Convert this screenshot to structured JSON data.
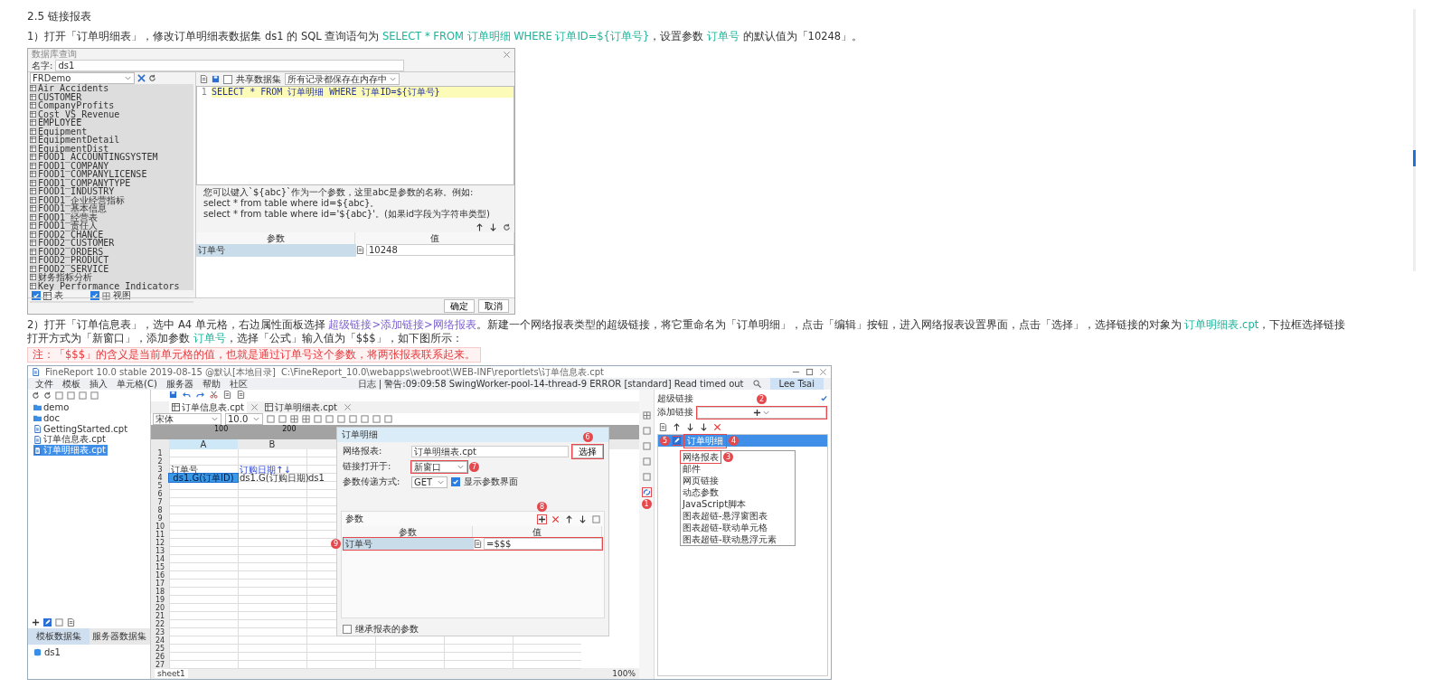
{
  "heading": "2.5 链接报表",
  "step_1": {
    "segments": [
      {
        "kind": "text",
        "text": "1）打开「订单明细表」，修改订单明细表数据集 ds1 的 SQL 查询语句为 "
      },
      {
        "kind": "code",
        "text": "SELECT * FROM 订单明细 WHERE 订单ID=${订单号}"
      },
      {
        "kind": "text",
        "text": "，设置参数 "
      },
      {
        "kind": "code",
        "text": "订单号"
      },
      {
        "kind": "text",
        "text": " 的默认值为「10248」。"
      }
    ]
  },
  "query_dialog": {
    "title": "数据库查询",
    "name_label": "名字:",
    "name_value": "ds1",
    "connection": "FRDemo",
    "tables": [
      "Air_Accidents",
      "CUSTOMER",
      "CompanyProfits",
      "Cost_VS_Revenue",
      "EMPLOYEE",
      "Equipment",
      "EquipmentDetail",
      "EquipmentDist",
      "FOOD1_ACCOUNTINGSYSTEM",
      "FOOD1_COMPANY",
      "FOOD1_COMPANYLICENSE",
      "FOOD1_COMPANYTYPE",
      "FOOD1_INDUSTRY",
      "FOOD1_企业经营指标",
      "FOOD1_基本信息",
      "FOOD1_经营表",
      "FOOD1_责任人",
      "FOOD2_CHANCE",
      "FOOD2_CUSTOMER",
      "FOOD2_ORDERS",
      "FOOD2_PRODUCT",
      "FOOD2_SERVICE",
      "财务指标分析",
      "Key Performance Indicators"
    ],
    "show_tables": {
      "label": "表",
      "checked": true
    },
    "show_views": {
      "label": "视图",
      "checked": true
    },
    "share_dataset": {
      "label": "共享数据集",
      "checked": false
    },
    "storage_mode": "所有记录都保存在内存中",
    "sql_lines": [
      {
        "number": "1",
        "text": "SELECT * FROM 订单明细 WHERE 订单ID=${订单号}"
      }
    ],
    "hint_lines": [
      "您可以键入`${abc}`作为一个参数，这里abc是参数的名称。例如:",
      "select * from table where id=${abc}。",
      "select * from table where id='${abc}'。(如果id字段为字符串类型)"
    ],
    "param_columns": [
      "参数",
      "值"
    ],
    "params": [
      {
        "name": "订单号",
        "value": "10248",
        "selected": true
      }
    ],
    "buttons": [
      "确定",
      "取消"
    ]
  },
  "step_2": {
    "segments": [
      {
        "kind": "text",
        "text": "2）打开「订单信息表」，选中 A4 单元格，右边属性面板选择 "
      },
      {
        "kind": "path",
        "text": "超级链接>添加链接>网络报表"
      },
      {
        "kind": "text",
        "text": "。新建一个网络报表类型的超级链接，将它重命名为「订单明细」，点击「编辑」按钮，进入网络报表设置界面，点击「选择」，选择链接的对象为 "
      },
      {
        "kind": "code",
        "text": "订单明细表.cpt"
      },
      {
        "kind": "text",
        "text": "，下拉框选择链接打开方式为「新窗口」，添加参数 "
      },
      {
        "kind": "code",
        "text": "订单号"
      },
      {
        "kind": "text",
        "text": "，选择「公式」输入值为「$$$」，如下图所示："
      }
    ]
  },
  "note": "注：「$$$」的含义是当前单元格的值，也就是通过订单号这个参数，将两张报表联系起来。",
  "designer_window": {
    "title": "FineReport 10.0 stable 2019-08-15 @默认[本地目录]",
    "path": "C:\\FineReport_10.0\\webapps\\webroot\\WEB-INF\\reportlets\\订单信息表.cpt",
    "menu": [
      "文件",
      "模板",
      "插入",
      "单元格(C)",
      "服务器",
      "帮助",
      "社区"
    ],
    "log": "日志 | 警告:09:09:58 SwingWorker-pool-14-thread-9 ERROR [standard] Read timed out",
    "user": "Lee Tsai",
    "file_tree": [
      {
        "label": "demo",
        "kind": "folder",
        "selected": false
      },
      {
        "label": "doc",
        "kind": "folder",
        "selected": false
      },
      {
        "label": "GettingStarted.cpt",
        "kind": "file",
        "selected": false
      },
      {
        "label": "订单信息表.cpt",
        "kind": "file",
        "selected": false
      },
      {
        "label": "订单明细表.cpt",
        "kind": "file",
        "selected": true
      }
    ],
    "dataset_tabs": [
      {
        "label": "模板数据集",
        "selected": true
      },
      {
        "label": "服务器数据集",
        "selected": false
      }
    ],
    "datasets": [
      "ds1"
    ],
    "doc_tabs": [
      {
        "label": "订单信息表.cpt",
        "selected": true
      },
      {
        "label": "订单明细表.cpt",
        "selected": false
      }
    ],
    "font": "宋体",
    "font_size": "10.0",
    "ruler_labels": [
      "100",
      "200"
    ],
    "columns": [
      "A",
      "B"
    ],
    "rows": [
      {
        "number": "1",
        "cells": []
      },
      {
        "number": "2",
        "cells": []
      },
      {
        "number": "3",
        "cells": [
          {
            "text": "订单号",
            "selected": false
          },
          {
            "text": "订购日期↑↓",
            "selected": false
          }
        ]
      },
      {
        "number": "4",
        "cells": [
          {
            "text": "ds1.G(订单ID)",
            "selected": true
          },
          {
            "text": "ds1.G(订购日期)",
            "selected": false
          },
          {
            "text": "ds1",
            "selected": false
          }
        ]
      },
      {
        "number": "5",
        "cells": []
      },
      {
        "number": "6",
        "cells": []
      },
      {
        "number": "7",
        "cells": []
      },
      {
        "number": "8",
        "cells": []
      },
      {
        "number": "9",
        "cells": []
      },
      {
        "number": "10",
        "cells": []
      },
      {
        "number": "11",
        "cells": []
      },
      {
        "number": "12",
        "cells": []
      },
      {
        "number": "13",
        "cells": []
      },
      {
        "number": "14",
        "cells": []
      },
      {
        "number": "15",
        "cells": []
      },
      {
        "number": "16",
        "cells": []
      },
      {
        "number": "17",
        "cells": []
      },
      {
        "number": "18",
        "cells": []
      },
      {
        "number": "19",
        "cells": []
      },
      {
        "number": "20",
        "cells": []
      },
      {
        "number": "21",
        "cells": []
      },
      {
        "number": "22",
        "cells": []
      },
      {
        "number": "23",
        "cells": []
      },
      {
        "number": "24",
        "cells": []
      },
      {
        "number": "25",
        "cells": []
      },
      {
        "number": "26",
        "cells": []
      },
      {
        "number": "27",
        "cells": []
      }
    ],
    "link_dialog": {
      "title": "订单明细",
      "report_label": "网络报表:",
      "report_value": "订单明细表.cpt",
      "choose_button": "选择",
      "choose_badge": "6",
      "open_label": "链接打开于:",
      "open_value": "新窗口",
      "open_badge": "7",
      "method_label": "参数传递方式:",
      "method_value": "GET",
      "show_params": {
        "label": "显示参数界面",
        "checked": true
      },
      "params_title": "参数",
      "add_badge": "8",
      "param_columns": [
        "参数",
        "值"
      ],
      "params": [
        {
          "name": "订单号",
          "value": "=$$$",
          "badge": "9"
        }
      ],
      "inherit": {
        "label": "继承报表的参数",
        "checked": false
      }
    },
    "hyperlink_badge": "1",
    "hyperlink_panel": {
      "title": "超级链接",
      "add_label": "添加链接",
      "add_badge": "2",
      "edit_badge": "5",
      "links": [
        {
          "label": "订单明细",
          "selected": true,
          "badge": "4"
        }
      ],
      "link_types": [
        {
          "label": "网络报表",
          "badge": "3"
        },
        {
          "label": "邮件"
        },
        {
          "label": "网页链接"
        },
        {
          "label": "动态参数"
        },
        {
          "label": "JavaScript脚本"
        },
        {
          "label": "图表超链-悬浮窗图表"
        },
        {
          "label": "图表超链-联动单元格"
        },
        {
          "label": "图表超链-联动悬浮元素"
        }
      ]
    },
    "sheet": "sheet1",
    "zoom": "100%"
  }
}
